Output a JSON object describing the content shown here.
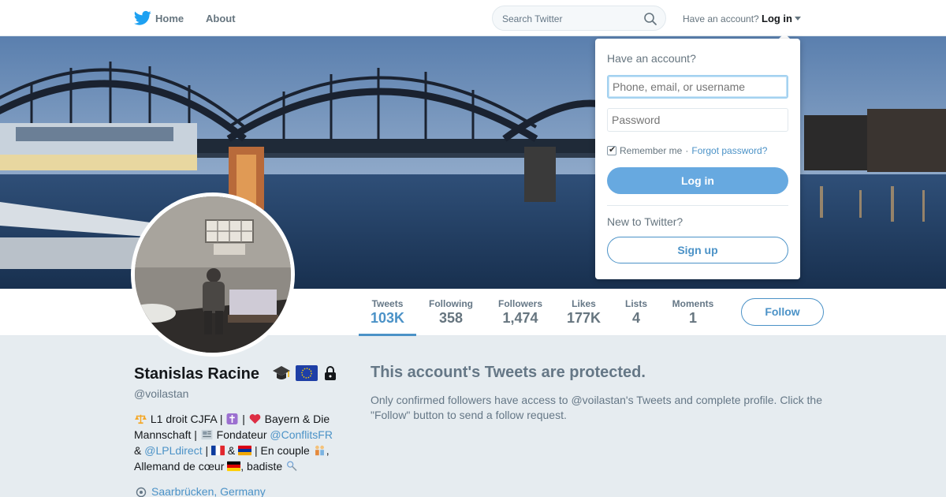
{
  "nav": {
    "home_label": "Home",
    "about_label": "About",
    "search_placeholder": "Search Twitter",
    "have_account": "Have an account?",
    "login_label": "Log in"
  },
  "profile": {
    "name": "Stanislas Racine",
    "handle": "@voilastan",
    "bio": {
      "part1": " L1 droit CJFA | ",
      "part2": " | ",
      "part3": " Bayern & Die Mannschaft | ",
      "part4": " Fondateur ",
      "link1": "@ConflitsFR",
      "part5": " & ",
      "link2": "@LPLdirect",
      "part6": " | ",
      "part7": " & ",
      "part8": " | En couple ",
      "part9": ", Allemand de cœur ",
      "part10": ", badiste "
    },
    "location": "Saarbrücken, Germany"
  },
  "stats": [
    {
      "label": "Tweets",
      "value": "103K"
    },
    {
      "label": "Following",
      "value": "358"
    },
    {
      "label": "Followers",
      "value": "1,474"
    },
    {
      "label": "Likes",
      "value": "177K"
    },
    {
      "label": "Lists",
      "value": "4"
    },
    {
      "label": "Moments",
      "value": "1"
    }
  ],
  "follow_label": "Follow",
  "protected": {
    "title": "This account's Tweets are protected.",
    "text": "Only confirmed followers have access to @voilastan's Tweets and complete profile. Click the \"Follow\" button to send a follow request."
  },
  "login_dropdown": {
    "title": "Have an account?",
    "username_placeholder": "Phone, email, or username",
    "password_placeholder": "Password",
    "remember_label": "Remember me",
    "separator": " · ",
    "forgot_label": "Forgot password?",
    "login_button": "Log in",
    "new_prompt": "New to Twitter?",
    "signup_button": "Sign up"
  },
  "colors": {
    "accent": "#4b92c7",
    "login_button_bg": "#67a9e0",
    "page_bg": "#e6ecf0",
    "muted_text": "#657786"
  }
}
